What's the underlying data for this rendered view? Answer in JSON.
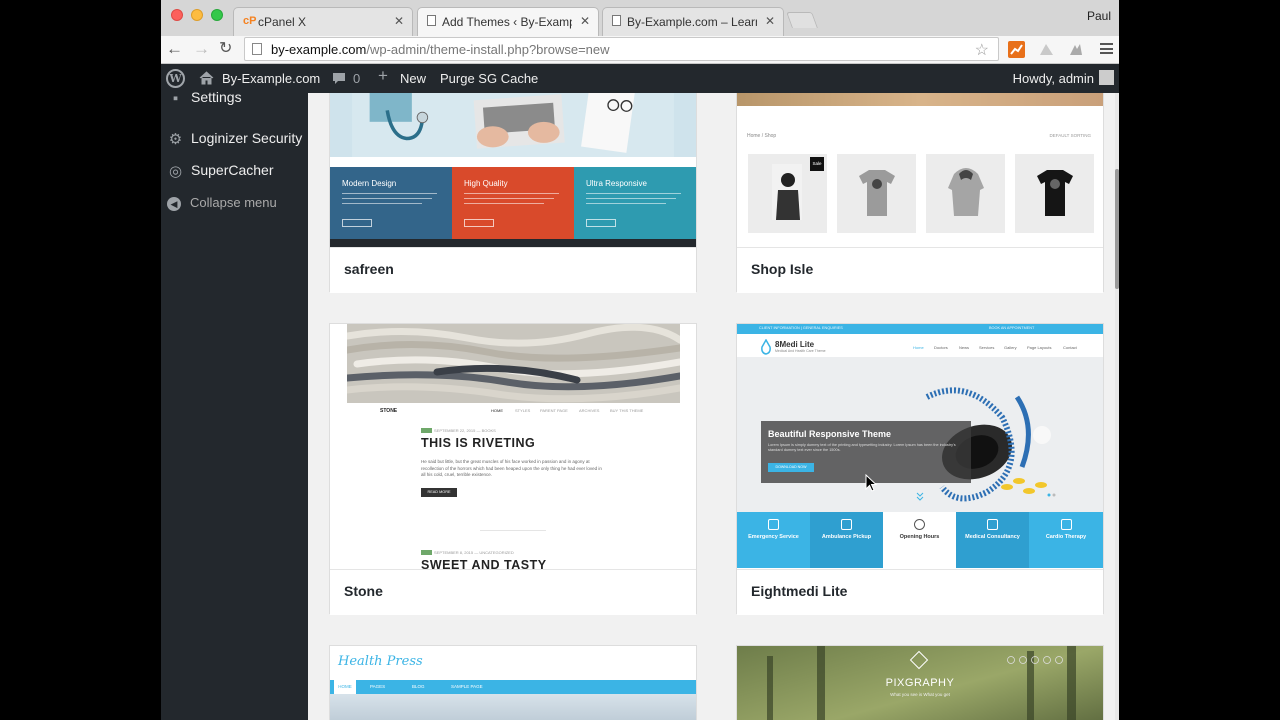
{
  "browser": {
    "tabs": [
      {
        "favicon": "cP",
        "title": "cPanel X",
        "active": false
      },
      {
        "favicon": "page-icon",
        "title": "Add Themes ‹ By-Example",
        "active": true
      },
      {
        "favicon": "page-icon",
        "title": "By-Example.com – Learn E",
        "active": false
      }
    ],
    "profile_name": "Paul",
    "url_host": "by-example.com",
    "url_path": "/wp-admin/theme-install.php?browse=new"
  },
  "admin_bar": {
    "site_name": "By-Example.com",
    "comments_count": "0",
    "new_label": "New",
    "purge_label": "Purge SG Cache",
    "greeting": "Howdy, admin"
  },
  "sidebar": {
    "items": [
      {
        "label": "Settings",
        "icon": "settings-icon"
      },
      {
        "label": "Loginizer Security",
        "icon": "gear-icon"
      },
      {
        "label": "SuperCacher",
        "icon": "supercacher-icon"
      }
    ],
    "collapse_label": "Collapse menu"
  },
  "themes": [
    {
      "name": "safreen"
    },
    {
      "name": "Shop Isle"
    },
    {
      "name": "Stone"
    },
    {
      "name": "Eightmedi Lite"
    }
  ],
  "previews": {
    "safreen": {
      "panels": [
        "Modern Design",
        "High Quality",
        "Ultra Responsive"
      ]
    },
    "shopisle": {
      "breadcrumb": "Home / Shop",
      "sorting": "DEFAULT SORTING",
      "sale_badge": "Sale"
    },
    "stone": {
      "logo": "STONE",
      "nav": [
        "HOME",
        "STYLES",
        "PARENT PAGE",
        "ARCHIVES",
        "BUY THIS THEME"
      ],
      "post1_meta": "SEPTEMBER 22, 2015 — BOOKS",
      "post1_title": "THIS IS RIVETING",
      "post1_excerpt": "He said but little, but the great muscles of his face worked in passion and in agony at recollection of the horrors which had been heaped upon the only thing he had ever loved in all his cold, cruel, terrible existence.",
      "read_more": "READ MORE",
      "post2_meta": "SEPTEMBER 8, 2015 — UNCATEGORIZED",
      "post2_title": "SWEET AND TASTY"
    },
    "eightmedi": {
      "topbar_left": "CLIENT INFORMATION  |  GENERAL ENQUIRIES",
      "topbar_right": "BOOK AN APPOINTMENT",
      "logo": "8Medi Lite",
      "tagline": "Medical And Health Care Theme",
      "nav": [
        "Home",
        "Doctors",
        "News",
        "Services",
        "Gallery",
        "Page Layouts",
        "Contact"
      ],
      "hero_title": "Beautiful Responsive Theme",
      "hero_text": "Lorem Ipsum is simply dummy text of the printing and typesetting industry. Lorem Ipsum has been the industry's standard dummy text ever since the 1500s.",
      "hero_button": "DOWNLOAD NOW",
      "tiles": [
        "Emergency Service",
        "Ambulance Pickup",
        "Opening Hours",
        "Medical Consultancy",
        "Cardio Therapy"
      ]
    },
    "healthpress": {
      "logo": "Health Press",
      "nav": [
        "HOME",
        "PAGES",
        "BLOG",
        "SAMPLE PAGE"
      ]
    },
    "pixgraphy": {
      "logo": "PIXGRAPHY",
      "tagline": "What you see is What you get"
    }
  },
  "colors": {
    "wp_dark": "#23282d",
    "medi_blue": "#3bb4e5",
    "saf_blue": "#33658a",
    "saf_red": "#d94a2b",
    "saf_teal": "#2e9bb0"
  }
}
